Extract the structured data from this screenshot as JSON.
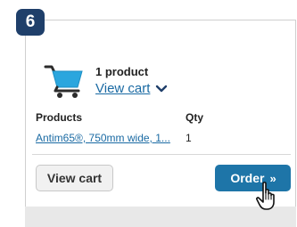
{
  "step": {
    "number": "6"
  },
  "cart": {
    "count_text": "1 product",
    "view_cart_link": "View cart",
    "icon": "shopping-cart-icon"
  },
  "table": {
    "headers": {
      "products": "Products",
      "qty": "Qty"
    },
    "rows": [
      {
        "product": "Antim65®, 750mm wide, 1...",
        "qty": "1"
      }
    ]
  },
  "actions": {
    "view_cart_button": "View cart",
    "order_button": "Order",
    "order_arrows": "»"
  },
  "colors": {
    "badge": "#1f3f6a",
    "cart_icon": "#2aa6de",
    "link": "#1a6aa3",
    "order_button": "#1e75a8"
  }
}
